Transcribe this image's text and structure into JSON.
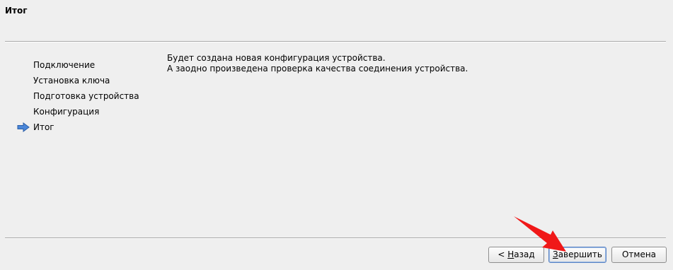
{
  "header": {
    "title": "Итог"
  },
  "steps": [
    {
      "label": "Подключение",
      "current": false
    },
    {
      "label": "Установка ключа",
      "current": false
    },
    {
      "label": "Подготовка устройства",
      "current": false
    },
    {
      "label": "Конфигурация",
      "current": false
    },
    {
      "label": "Итог",
      "current": true
    }
  ],
  "content": {
    "line1": "Будет создана новая конфигурация устройства.",
    "line2": "А заодно произведена проверка качества соединения устройства."
  },
  "buttons": {
    "back_prefix": "< ",
    "back_mnemonic": "Н",
    "back_rest": "азад",
    "finish_mnemonic": "З",
    "finish_rest": "авершить",
    "cancel": "Отмена"
  },
  "colors": {
    "background": "#efefef",
    "current_step_arrow": "#4a86d8",
    "annotation_arrow": "#f01818"
  },
  "icons": {
    "current_step": "arrow-right-icon",
    "annotation": "red-pointer-arrow-icon"
  }
}
